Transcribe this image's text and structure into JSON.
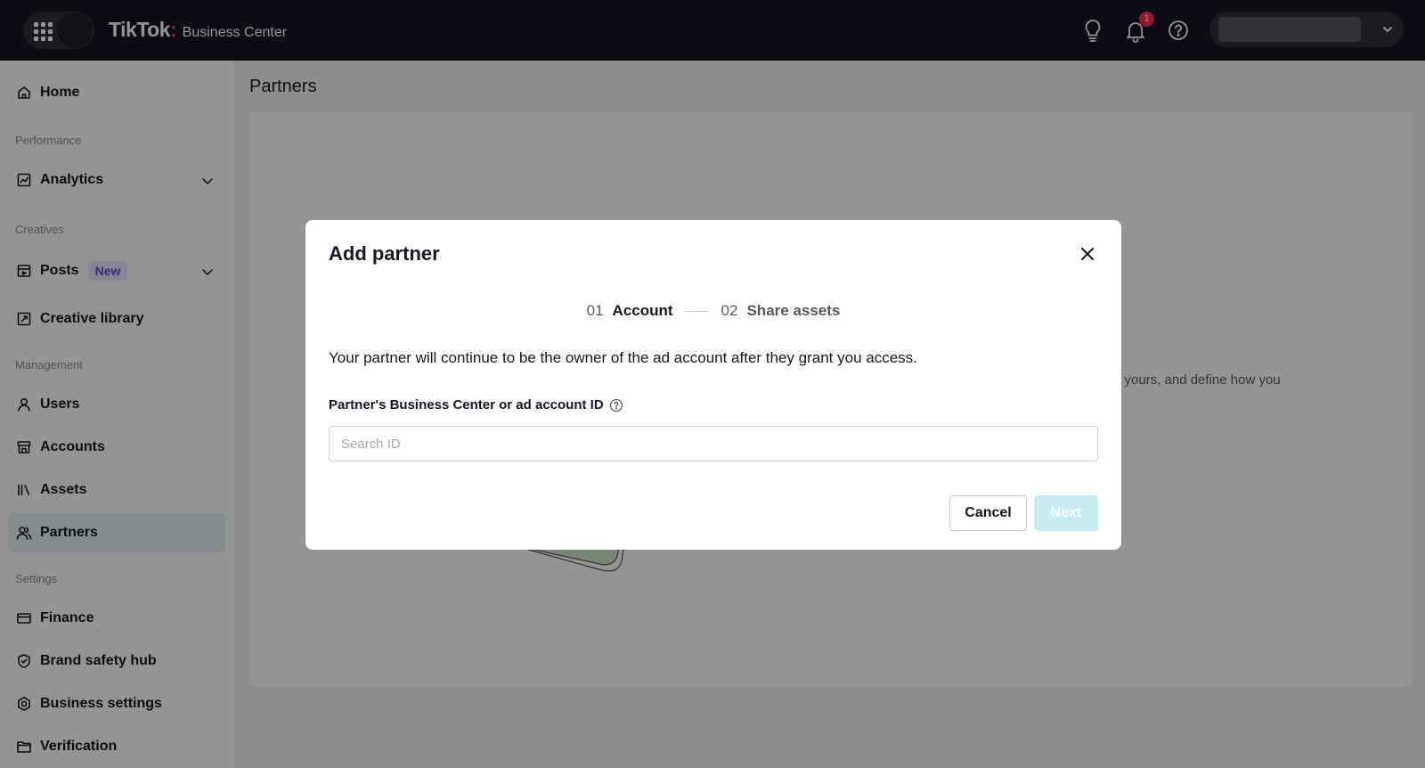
{
  "topbar": {
    "brand_logo": "TikTok",
    "brand_dot": ":",
    "brand_sub": "Business Center",
    "notification_count": "1"
  },
  "sidebar": {
    "home": "Home",
    "section_performance": "Performance",
    "analytics": "Analytics",
    "section_creatives": "Creatives",
    "posts": "Posts",
    "posts_badge": "New",
    "creative_library": "Creative library",
    "section_management": "Management",
    "users": "Users",
    "accounts": "Accounts",
    "assets": "Assets",
    "partners": "Partners",
    "section_settings": "Settings",
    "finance": "Finance",
    "brand_safety_hub": "Brand safety hub",
    "business_settings": "Business settings",
    "verification": "Verification"
  },
  "main": {
    "page_title": "Partners",
    "bg_description_fragment": "o yours, and define how you"
  },
  "modal": {
    "title": "Add partner",
    "steps": [
      {
        "num": "01",
        "label": "Account"
      },
      {
        "num": "02",
        "label": "Share assets"
      }
    ],
    "description": "Your partner will continue to be the owner of the ad account after they grant you access.",
    "field_label": "Partner's Business Center or ad account ID",
    "search_placeholder": "Search ID",
    "search_value": "",
    "cancel_label": "Cancel",
    "next_label": "Next"
  },
  "colors": {
    "topbar_bg": "#161823",
    "accent_brand": "#fe2c55",
    "next_disabled": "#c8ebef",
    "active_nav_bg": "#e3f3f4",
    "badge_new_bg": "#e8e6fd"
  }
}
